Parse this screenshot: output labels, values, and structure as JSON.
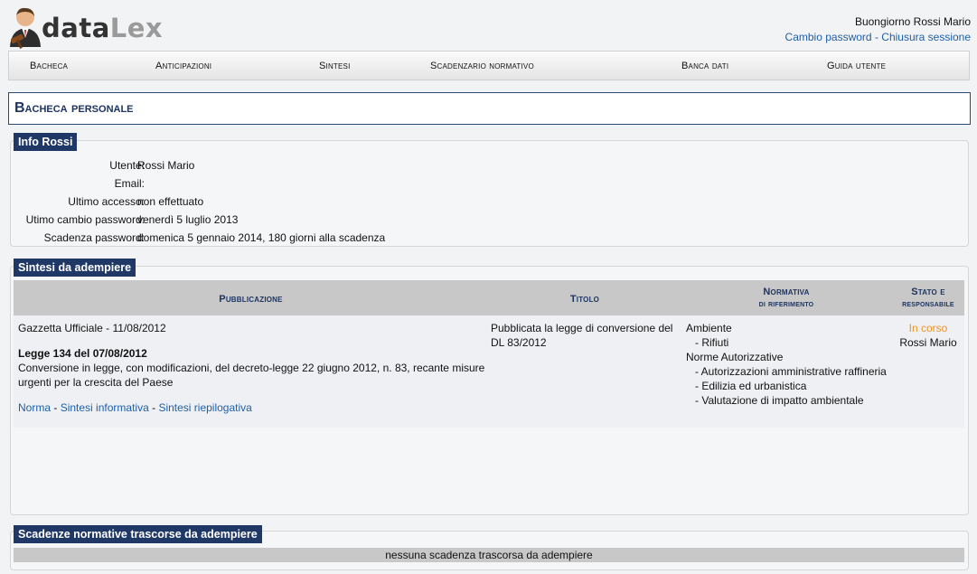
{
  "header": {
    "logo_part1": "data",
    "logo_part2": "Lex",
    "greeting": "Buongiorno Rossi Mario",
    "change_password": "Cambio password",
    "separator": "-",
    "logout": "Chiusura sessione"
  },
  "nav": [
    {
      "label": "Bacheca"
    },
    {
      "label": "Anticipazioni"
    },
    {
      "label": "Sintesi"
    },
    {
      "label": "Scadenzario normativo"
    },
    {
      "label": "Banca dati"
    },
    {
      "label": "Guida utente"
    }
  ],
  "page_title": "Bacheca personale",
  "info": {
    "tab": "Info Rossi",
    "rows": [
      {
        "label": "Utente:",
        "value": "Rossi Mario"
      },
      {
        "label": "Email:",
        "value": ""
      },
      {
        "label": "Ultimo accesso:",
        "value": "non effettuato"
      },
      {
        "label": "Utimo cambio password:",
        "value": "venerdì 5 luglio 2013"
      },
      {
        "label": "Scadenza password:",
        "value": "domenica 5 gennaio 2014, 180 giorni alla scadenza"
      }
    ]
  },
  "sintesi": {
    "tab": "Sintesi da adempiere",
    "columns": {
      "pubblicazione": "Pubblicazione",
      "titolo": "Titolo",
      "normativa_1": "Normativa",
      "normativa_2": "di riferimento",
      "stato_1": "Stato e",
      "stato_2": "responsabile"
    },
    "row": {
      "gazzetta": "Gazzetta Ufficiale - 11/08/2012",
      "legge": "Legge 134 del 07/08/2012",
      "descr_1": "Conversione in legge, con modificazioni, del decreto-legge 22 giugno 2012, n. 83, recante misure",
      "descr_2": "urgenti per la crescita del Paese",
      "link_norma": "Norma",
      "link_sep": "-",
      "link_informativa": "Sintesi informativa",
      "link_riepilogativa": "Sintesi riepilogativa",
      "titolo_1": "Pubblicata la legge di conversione del",
      "titolo_2": "DL 83/2012",
      "norm_lines": [
        "Ambiente",
        "- Rifiuti",
        "Norme Autorizzative",
        "- Autorizzazioni amministrative raffineria",
        "- Edilizia ed urbanistica",
        "- Valutazione di impatto ambientale"
      ],
      "stato": "In corso",
      "responsabile": "Rossi Mario",
      "stato_color": "#e8962b"
    }
  },
  "scadenze": {
    "tab": "Scadenze normative trascorse da adempiere",
    "empty_text": "nessuna scadenza trascorsa da adempiere"
  },
  "colors": {
    "tab_bg": "#1f3866",
    "link": "#1f5fa6",
    "title": "#1d3461"
  }
}
